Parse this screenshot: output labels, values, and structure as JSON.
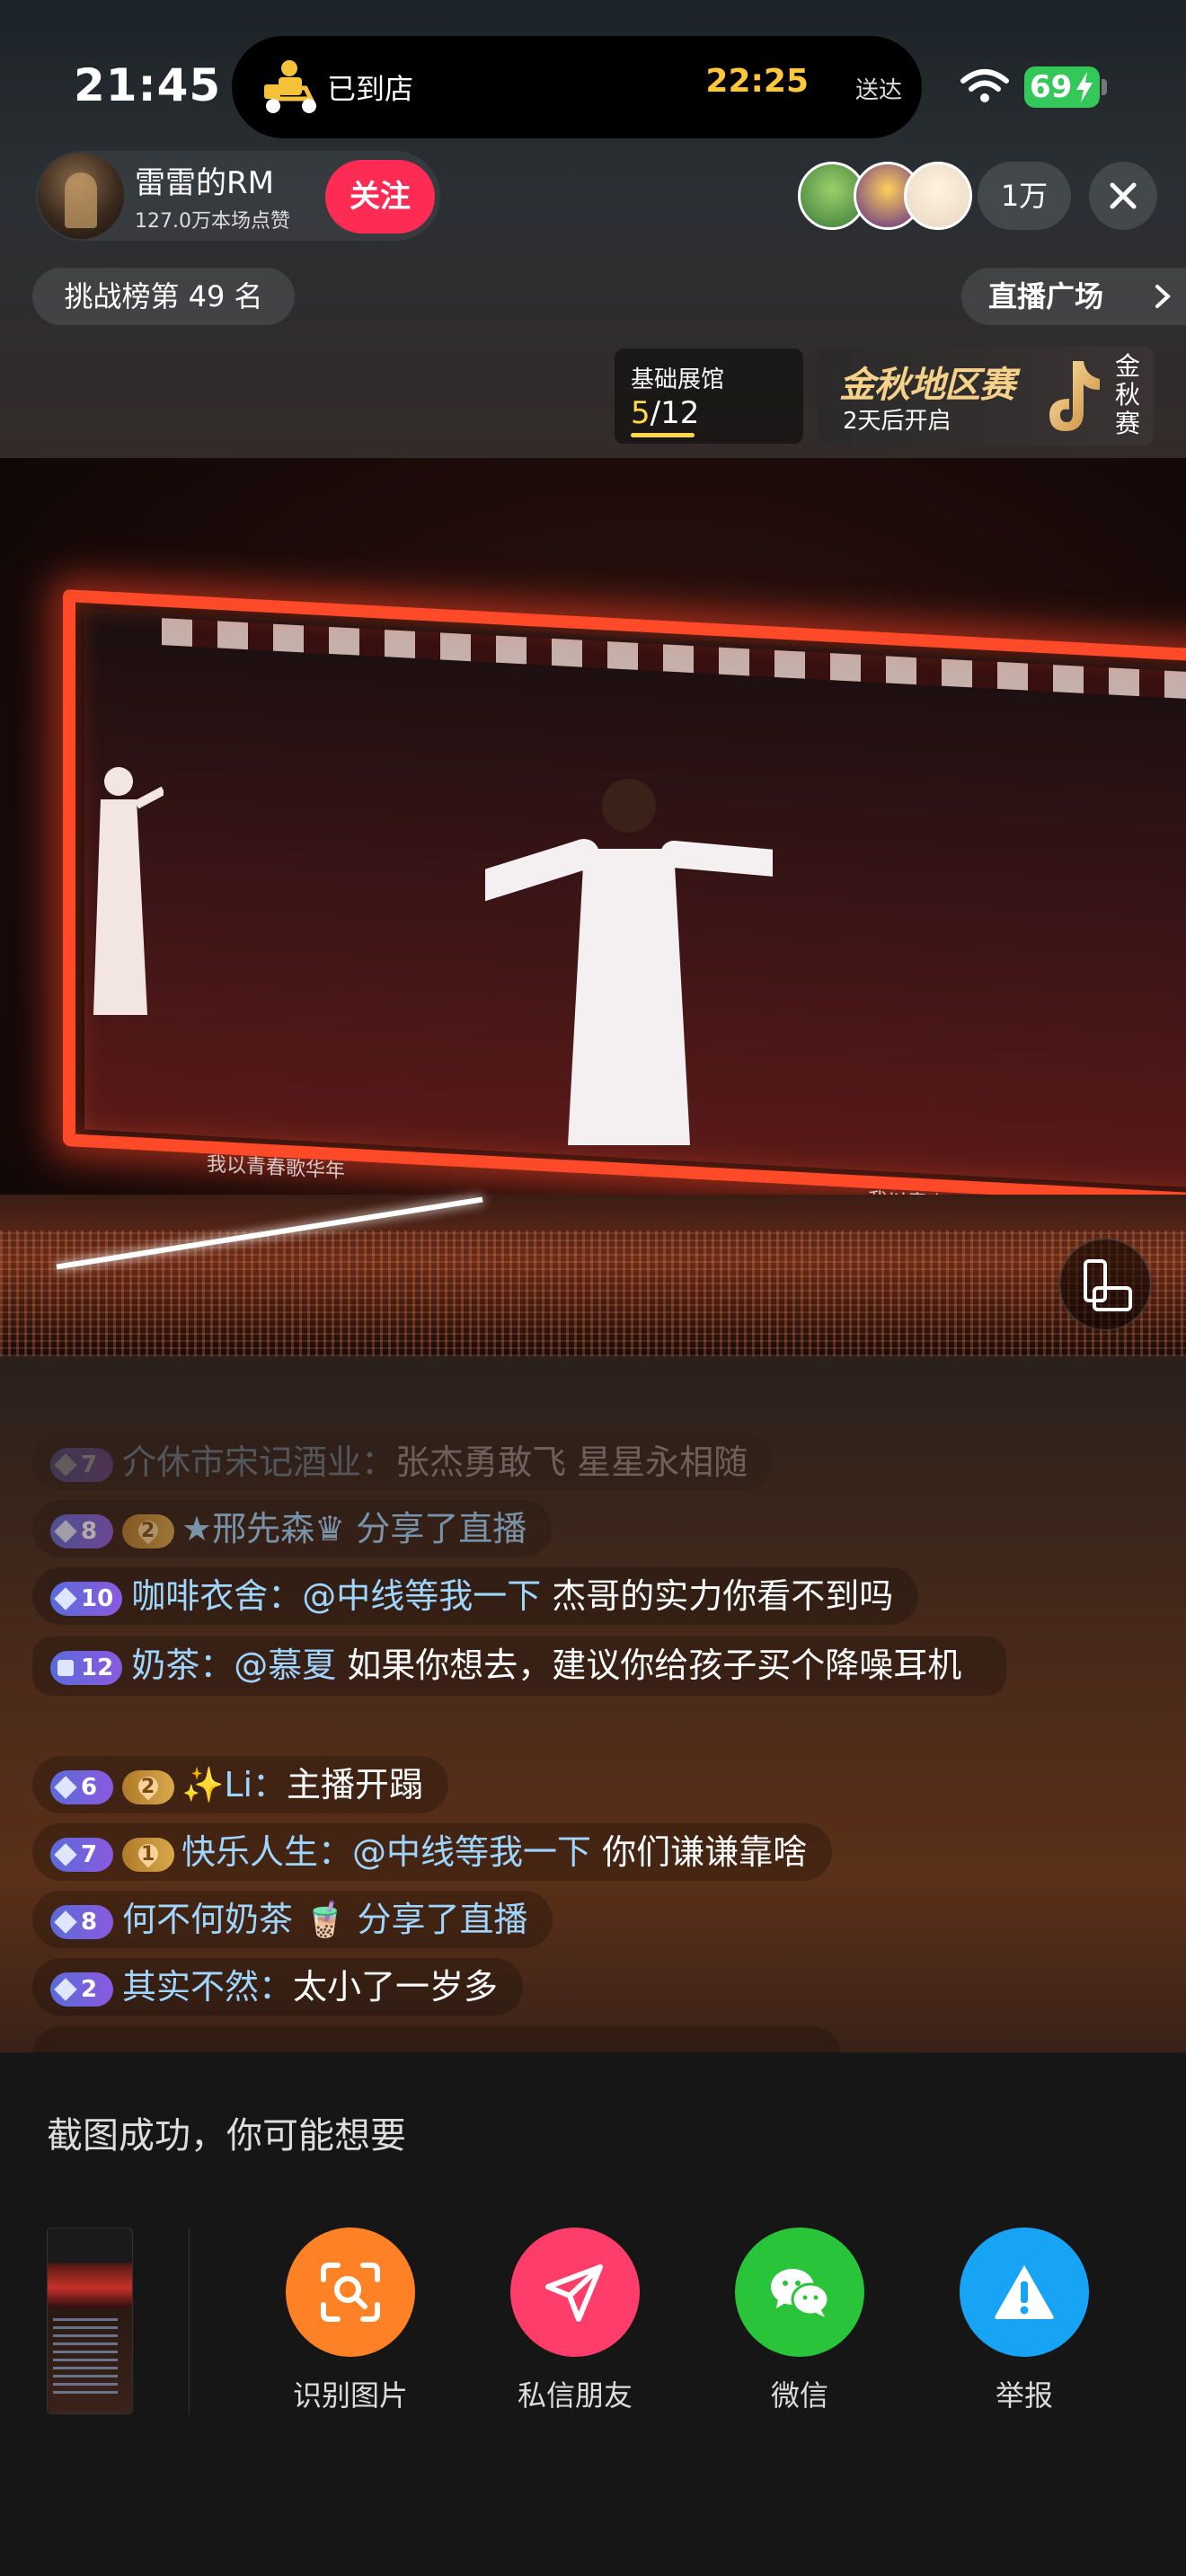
{
  "status_bar": {
    "time": "21:45",
    "battery": "69",
    "delivery": {
      "status": "已到店",
      "eta": "22:25",
      "eta_suffix": "送达"
    }
  },
  "header": {
    "host_name": "雷雷的RM",
    "host_likes": "127.0万本场点赞",
    "follow_label": "关注",
    "viewer_count": "1万",
    "rank_label": "挑战榜第 49 名",
    "square_label": "直播广场",
    "hall": {
      "label": "基础展馆",
      "current": "5",
      "total": "/12",
      "progress": 0.4167
    },
    "match": {
      "title": "金秋地区赛",
      "sub": "2天后开启",
      "vertical": [
        "金",
        "秋",
        "赛"
      ]
    }
  },
  "video": {
    "caption": "我以青春歌华年"
  },
  "chat": [
    {
      "level": "7",
      "fan": null,
      "user": "介休市宋记酒业：",
      "mention": "",
      "text": "张杰勇敢飞    星星永相随",
      "style": "fade"
    },
    {
      "level": "8",
      "fan": "2",
      "user": "★邢先森♛ 分享了直播",
      "mention": "",
      "text": "",
      "style": "semi"
    },
    {
      "level": "10",
      "fan": null,
      "user": "咖啡衣舍：",
      "mention": "@中线等我一下",
      "text": " 杰哥的实力你看不到吗",
      "style": ""
    },
    {
      "level": "12",
      "fan": null,
      "user": "奶茶：",
      "mention": "@慕夏",
      "text": " 如果你想去，建议你给孩子买个降噪耳机",
      "style": "multi"
    },
    {
      "level": "6",
      "fan": "2",
      "user": "✨Li：",
      "mention": "",
      "text": "主播开蹋",
      "style": ""
    },
    {
      "level": "7",
      "fan": "1",
      "user": "快乐人生：",
      "mention": "@中线等我一下",
      "text": " 你们谦谦靠啥",
      "style": ""
    },
    {
      "level": "8",
      "fan": null,
      "user": "何不何奶茶 🧋 分享了直播",
      "mention": "",
      "text": "",
      "style": ""
    },
    {
      "level": "2",
      "fan": null,
      "user": "其实不然：",
      "mention": "",
      "text": "太小了一岁多",
      "style": ""
    }
  ],
  "sheet": {
    "title": "截图成功，你可能想要",
    "actions": [
      {
        "label": "识别图片",
        "icon": "image-scan-icon",
        "color": "#ff8126"
      },
      {
        "label": "私信朋友",
        "icon": "paper-plane-icon",
        "color": "#fe3d6a"
      },
      {
        "label": "微信",
        "icon": "wechat-icon",
        "color": "#2ac43a"
      },
      {
        "label": "举报",
        "icon": "warning-icon",
        "color": "#17a4f5"
      }
    ]
  }
}
